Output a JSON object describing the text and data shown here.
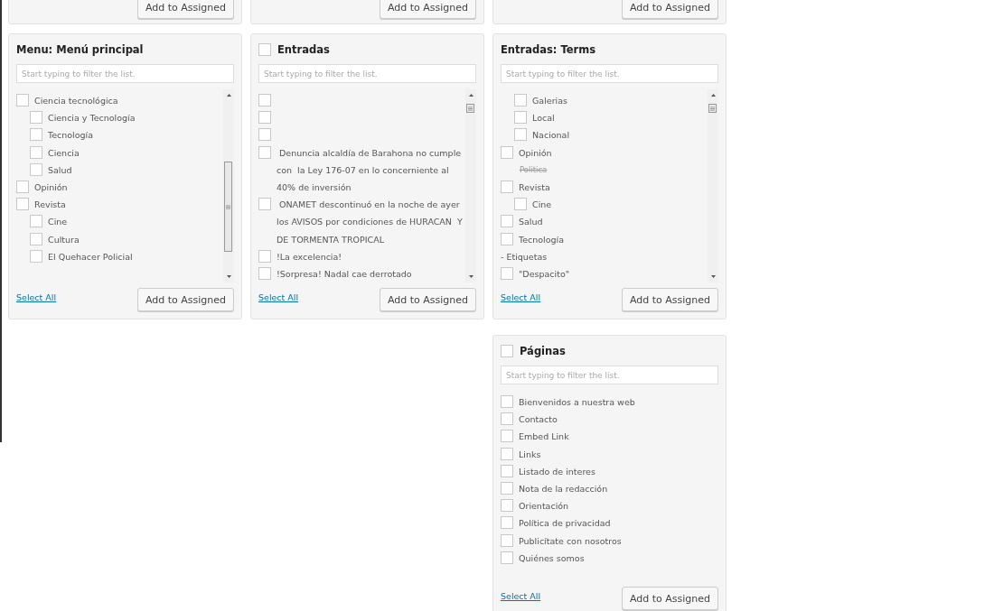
{
  "top_panels": [
    {
      "button": "Add to Assigned"
    },
    {
      "button": "Add to Assigned"
    },
    {
      "button": "Add to Assigned"
    }
  ],
  "panels": [
    {
      "title": "Menu: Menú principal",
      "placeholder": "Start typing to filter the list.",
      "scrollbar": true,
      "items": [
        {
          "label": "Ciencia tecnológica",
          "checked": false,
          "children": [
            {
              "label": "Ciencia y Tecnología",
              "checked": false
            },
            {
              "label": "Tecnología",
              "checked": false
            },
            {
              "label": "Ciencia",
              "checked": false
            },
            {
              "label": "Salud",
              "checked": false
            }
          ]
        },
        {
          "label": "Opinión",
          "checked": false
        },
        {
          "label": "Revista",
          "checked": false,
          "children": [
            {
              "label": "Cine",
              "checked": false
            },
            {
              "label": "Cultura",
              "checked": false
            },
            {
              "label": "El Quehacer Policial",
              "checked": false
            }
          ]
        }
      ],
      "select_all": "Select All",
      "button": "Add to Assigned"
    },
    {
      "title": "Entradas",
      "title_checkbox": {
        "checked": false
      },
      "placeholder": "Start typing to filter the list.",
      "scrollbar": true,
      "items": [
        {
          "checked": false
        },
        {
          "checked": false
        },
        {
          "checked": false
        },
        {
          "label": " Denuncia alcaldía de Barahona no cumple con  la Ley 176-07 en lo concerniente al 40% de inversión",
          "checked": false
        },
        {
          "label": " ONAMET descontinuó en la noche de ayer los AVISOS por condiciones de HURACAN  Y DE TORMENTA TROPICAL",
          "checked": false
        },
        {
          "label": "!La excelencia!",
          "checked": false
        },
        {
          "label": "!Sorpresa! Nadal cae derrotado",
          "checked": false
        }
      ],
      "select_all": "Select All",
      "button": "Add to Assigned"
    },
    {
      "title": "Entradas: Terms",
      "placeholder": "Start typing to filter the list.",
      "scrollbar": true,
      "items": [
        {
          "children": [
            {
              "label": "Galerias",
              "checked": false
            },
            {
              "label": "Local",
              "checked": false
            },
            {
              "label": "Nacional",
              "checked": false
            }
          ]
        },
        {
          "label": "Opinión",
          "checked": false
        },
        {
          "kind": "struck",
          "label": "Politica"
        },
        {
          "label": "Revista",
          "checked": false,
          "children": [
            {
              "label": "Cine",
              "checked": false
            }
          ]
        },
        {
          "label": "Salud",
          "checked": false
        },
        {
          "label": "Tecnología",
          "checked": false
        },
        {
          "kind": "heading",
          "label": "- Etiquetas"
        },
        {
          "label": "\"Despacito\"",
          "checked": false
        }
      ],
      "select_all": "Select All",
      "button": "Add to Assigned"
    },
    {
      "title": "Páginas",
      "title_checkbox": {
        "checked": false
      },
      "placeholder": "Start typing to filter the list.",
      "scrollbar": false,
      "items": [
        {
          "label": "Bienvenidos a nuestra web",
          "checked": false
        },
        {
          "label": "Contacto",
          "checked": false
        },
        {
          "label": "Embed Link",
          "checked": false
        },
        {
          "label": "Links",
          "checked": false
        },
        {
          "label": "Listado de interes",
          "checked": false
        },
        {
          "label": "Nota de la redacción",
          "checked": false
        },
        {
          "label": "Orientación",
          "checked": false
        },
        {
          "label": "Política de privacidad",
          "checked": false
        },
        {
          "label": "Publicítate con nosotros",
          "checked": false
        },
        {
          "label": "Quiénes somos",
          "checked": false
        }
      ],
      "select_all": "Select All",
      "button": "Add to Assigned"
    }
  ]
}
